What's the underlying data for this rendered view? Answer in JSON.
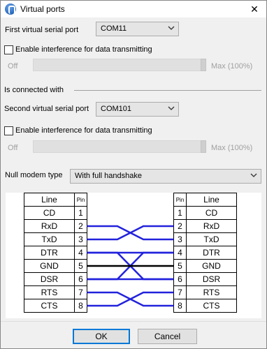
{
  "window": {
    "title": "Virtual ports",
    "close_glyph": "✕"
  },
  "first_port": {
    "label": "First virtual serial port",
    "value": "COM11",
    "interference_label": "Enable interference for data transmitting",
    "interference_checked": false,
    "slider_min": "Off",
    "slider_max": "Max (100%)",
    "slider_level": 1.0
  },
  "connected_label": "Is connected with",
  "second_port": {
    "label": "Second virtual serial port",
    "value": "COM101",
    "interference_label": "Enable interference for data transmitting",
    "interference_checked": false,
    "slider_min": "Off",
    "slider_max": "Max (100%)",
    "slider_level": 1.0
  },
  "null_modem": {
    "label": "Null modem type",
    "value": "With full handshake"
  },
  "diagram": {
    "headers": {
      "line": "Line",
      "pin": "Pin"
    },
    "left": [
      {
        "line": "CD",
        "pin": "1"
      },
      {
        "line": "RxD",
        "pin": "2"
      },
      {
        "line": "TxD",
        "pin": "3"
      },
      {
        "line": "DTR",
        "pin": "4"
      },
      {
        "line": "GND",
        "pin": "5"
      },
      {
        "line": "DSR",
        "pin": "6"
      },
      {
        "line": "RTS",
        "pin": "7"
      },
      {
        "line": "CTS",
        "pin": "8"
      }
    ],
    "right": [
      {
        "line": "CD",
        "pin": "1"
      },
      {
        "line": "RxD",
        "pin": "2"
      },
      {
        "line": "TxD",
        "pin": "3"
      },
      {
        "line": "DTR",
        "pin": "4"
      },
      {
        "line": "GND",
        "pin": "5"
      },
      {
        "line": "DSR",
        "pin": "6"
      },
      {
        "line": "RTS",
        "pin": "7"
      },
      {
        "line": "CTS",
        "pin": "8"
      }
    ],
    "wire_color": "#2222dd"
  },
  "buttons": {
    "ok": "OK",
    "cancel": "Cancel"
  }
}
